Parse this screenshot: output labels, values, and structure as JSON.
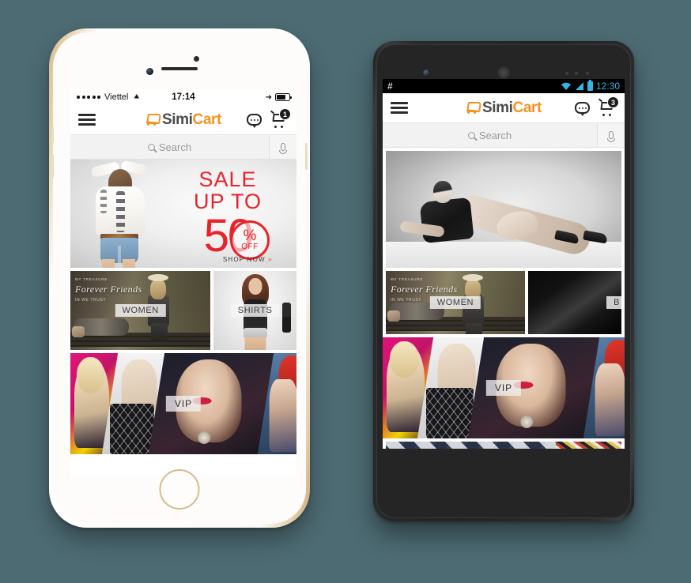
{
  "background_color": "#4d6b73",
  "devices": [
    {
      "id": "iphone",
      "type": "iphone-white-gold",
      "status_bar": {
        "carrier": "Viettel",
        "signal_dots": 5,
        "wifi_icon": "wifi-icon",
        "time": "17:14",
        "location_icon": "location-arrow-icon",
        "battery_icon": "battery-icon"
      },
      "appbar": {
        "menu_icon": "hamburger-menu-icon",
        "brand_icon": "simicart-cart-logo-icon",
        "brand_first": "Simi",
        "brand_second": "Cart",
        "brand_first_color": "#4a4a4a",
        "brand_second_color": "#f6921e",
        "chat_icon": "chat-bubble-icon",
        "cart_icon": "shopping-cart-icon",
        "cart_badge": "1"
      },
      "search": {
        "icon": "search-magnifier-icon",
        "placeholder": "Search",
        "value": "",
        "mic_icon": "microphone-icon"
      },
      "banner": {
        "line1": "SALE",
        "line2": "UP TO",
        "number": "50",
        "percent": "%",
        "off": "OFF",
        "cta": "SHOP NOW",
        "cta_arrow": "»",
        "accent_color": "#e8232a"
      },
      "categories": [
        {
          "label": "WOMEN",
          "overlay_text": "Forever Friends"
        },
        {
          "label": "SHIRTS"
        }
      ],
      "vip_banner": {
        "label": "VIP"
      }
    },
    {
      "id": "android",
      "type": "android-black",
      "status_bar": {
        "left_icon": "#",
        "wifi_icon": "wifi-icon",
        "signal_icon": "signal-bars-icon",
        "battery_icon": "battery-icon",
        "time": "12:30",
        "accent_color": "#33b5e5"
      },
      "appbar": {
        "menu_icon": "hamburger-menu-icon",
        "brand_icon": "simicart-cart-logo-icon",
        "brand_first": "Simi",
        "brand_second": "Cart",
        "chat_icon": "chat-bubble-icon",
        "cart_icon": "shopping-cart-icon",
        "cart_badge": "3"
      },
      "search": {
        "icon": "search-magnifier-icon",
        "placeholder": "Search",
        "value": "",
        "mic_icon": "microphone-icon"
      },
      "hero_banner": {
        "alt": "black-and-white-fashion-model"
      },
      "categories": [
        {
          "label": "WOMEN",
          "overlay_text": "Forever Friends"
        },
        {
          "label": "B"
        }
      ],
      "vip_banner": {
        "label": "VIP"
      },
      "bottom_strip": {
        "alt": "diamond-pattern-promo"
      }
    }
  ]
}
